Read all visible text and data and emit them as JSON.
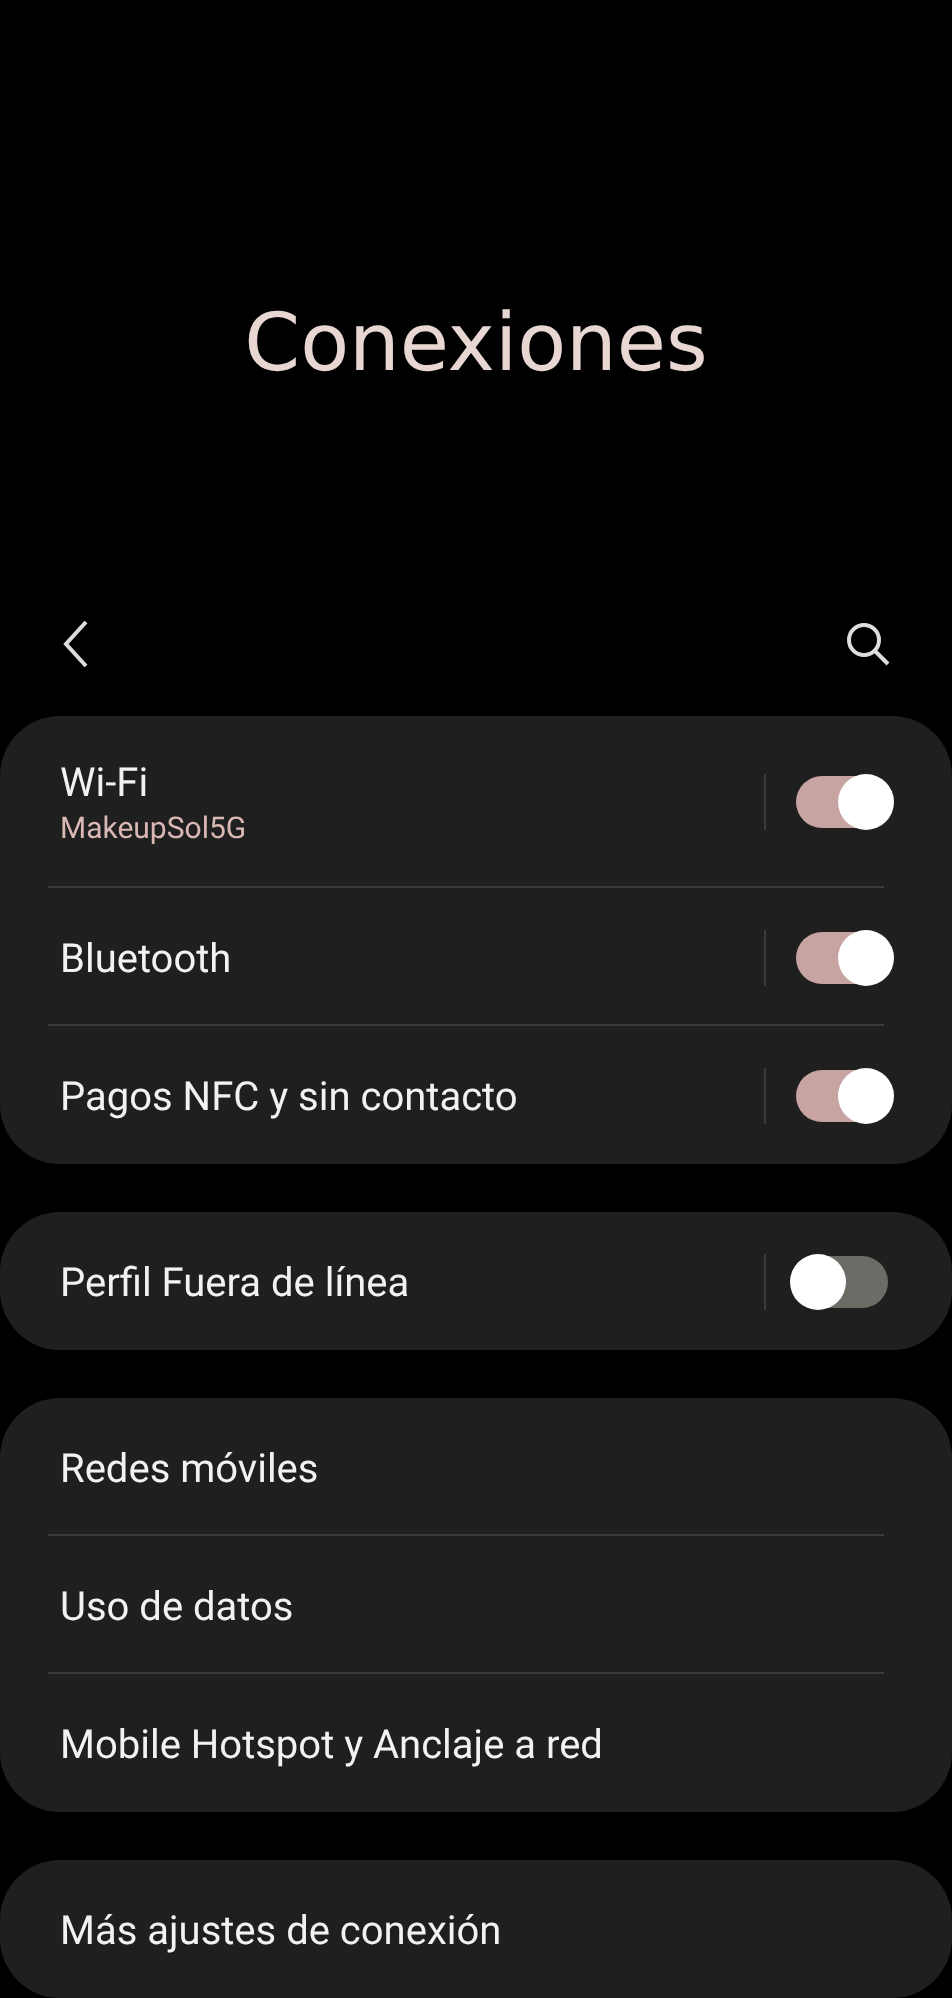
{
  "title": "Conexiones",
  "groups": [
    {
      "items": [
        {
          "label": "Wi-Fi",
          "subtitle": "MakeupSol5G",
          "kind": "toggle",
          "on": true
        },
        {
          "label": "Bluetooth",
          "kind": "toggle",
          "on": true
        },
        {
          "label": "Pagos NFC y sin contacto",
          "kind": "toggle",
          "on": true
        }
      ]
    },
    {
      "items": [
        {
          "label": "Perfil Fuera de línea",
          "kind": "toggle",
          "on": false
        }
      ]
    },
    {
      "items": [
        {
          "label": "Redes móviles",
          "kind": "link"
        },
        {
          "label": "Uso de datos",
          "kind": "link"
        },
        {
          "label": "Mobile Hotspot y Anclaje a red",
          "kind": "link"
        }
      ]
    },
    {
      "items": [
        {
          "label": "Más ajustes de conexión",
          "kind": "link"
        }
      ]
    }
  ]
}
